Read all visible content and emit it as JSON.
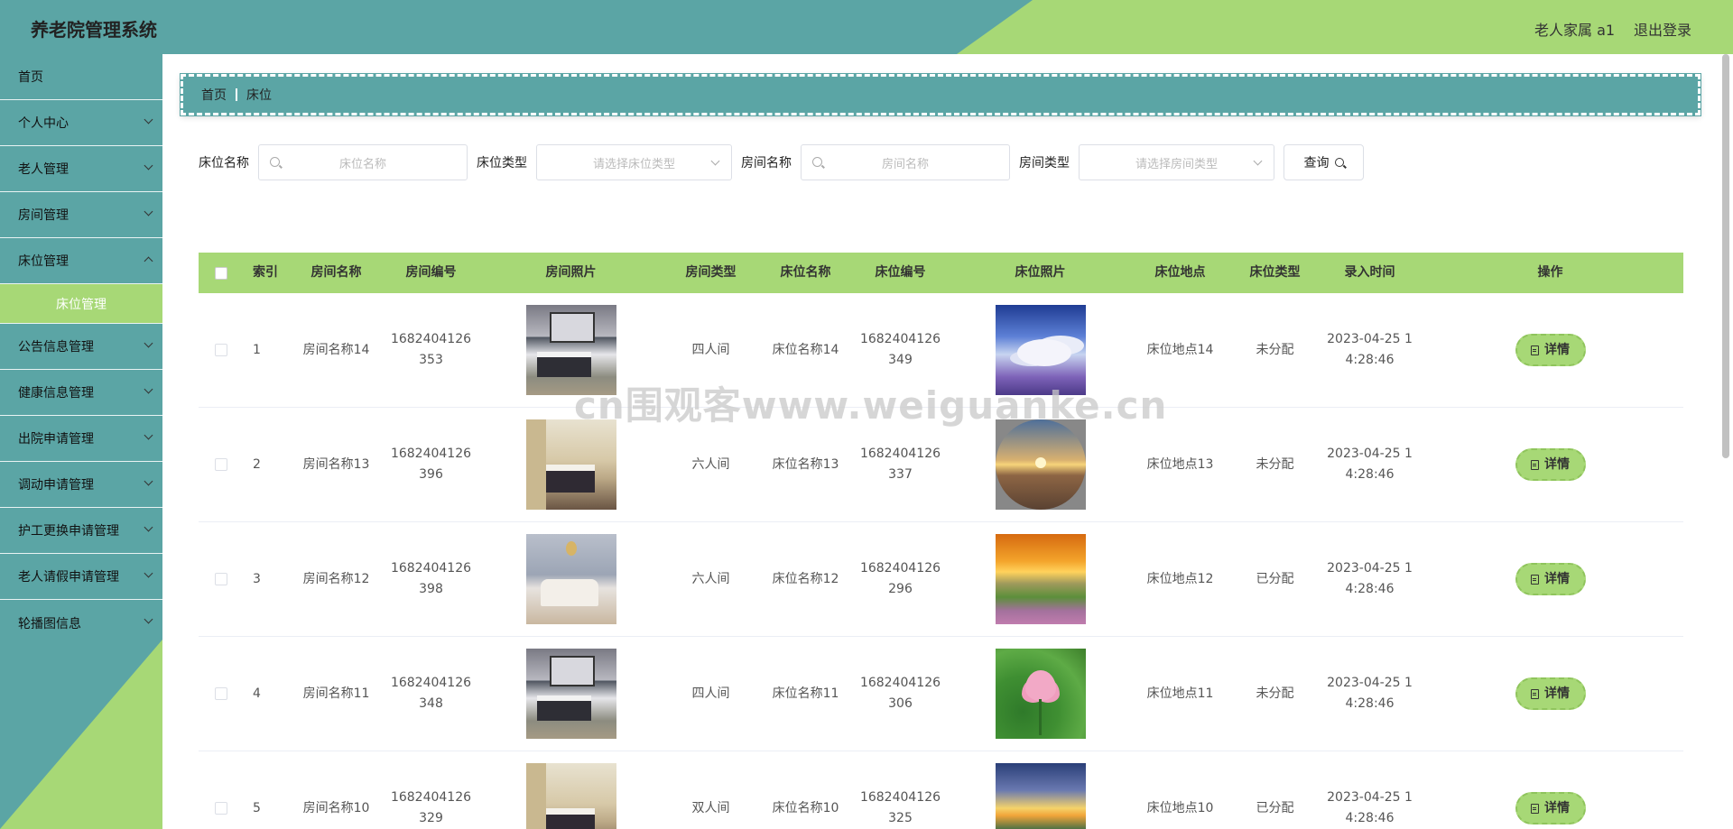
{
  "header": {
    "title": "养老院管理系统",
    "user": "老人家属 a1",
    "logout": "退出登录"
  },
  "colors": {
    "teal": "#5ba5a5",
    "green": "#a7d876"
  },
  "sidebar": {
    "items": [
      {
        "label": "首页"
      },
      {
        "label": "个人中心"
      },
      {
        "label": "老人管理"
      },
      {
        "label": "房间管理"
      },
      {
        "label": "床位管理"
      },
      {
        "label": "公告信息管理"
      },
      {
        "label": "健康信息管理"
      },
      {
        "label": "出院申请管理"
      },
      {
        "label": "调动申请管理"
      },
      {
        "label": "护工更换申请管理"
      },
      {
        "label": "老人请假申请管理"
      },
      {
        "label": "轮播图信息"
      }
    ],
    "active_sub": "床位管理"
  },
  "breadcrumb": {
    "home": "首页",
    "current": "床位"
  },
  "search": {
    "bed_name_label": "床位名称",
    "bed_name_placeholder": "床位名称",
    "bed_type_label": "床位类型",
    "bed_type_placeholder": "请选择床位类型",
    "room_name_label": "房间名称",
    "room_name_placeholder": "房间名称",
    "room_type_label": "房间类型",
    "room_type_placeholder": "请选择房间类型",
    "query_label": "查询"
  },
  "table": {
    "headers": {
      "index": "索引",
      "room_name": "房间名称",
      "room_no": "房间编号",
      "room_photo": "房间照片",
      "room_type": "房间类型",
      "bed_name": "床位名称",
      "bed_no": "床位编号",
      "bed_photo": "床位照片",
      "bed_location": "床位地点",
      "bed_type": "床位类型",
      "time": "录入时间",
      "op": "操作"
    },
    "detail_label": "详情",
    "rows": [
      {
        "index": "1",
        "room_name": "房间名称14",
        "room_no": "1682404126353",
        "room_type": "四人间",
        "bed_name": "床位名称14",
        "bed_no": "1682404126349",
        "bed_location": "床位地点14",
        "bed_type": "未分配",
        "time": "2023-04-25 14:28:46",
        "room_img": "room-a",
        "bed_img": "bed-sky"
      },
      {
        "index": "2",
        "room_name": "房间名称13",
        "room_no": "1682404126396",
        "room_type": "六人间",
        "bed_name": "床位名称13",
        "bed_no": "1682404126337",
        "bed_location": "床位地点13",
        "bed_type": "未分配",
        "time": "2023-04-25 14:28:46",
        "room_img": "room-b",
        "bed_img": "bed-sunset"
      },
      {
        "index": "3",
        "room_name": "房间名称12",
        "room_no": "1682404126398",
        "room_type": "六人间",
        "bed_name": "床位名称12",
        "bed_no": "1682404126296",
        "bed_location": "床位地点12",
        "bed_type": "已分配",
        "time": "2023-04-25 14:28:46",
        "room_img": "room-c",
        "bed_img": "bed-field"
      },
      {
        "index": "4",
        "room_name": "房间名称11",
        "room_no": "1682404126348",
        "room_type": "四人间",
        "bed_name": "床位名称11",
        "bed_no": "1682404126306",
        "bed_location": "床位地点11",
        "bed_type": "未分配",
        "time": "2023-04-25 14:28:46",
        "room_img": "room-a",
        "bed_img": "bed-lotus"
      },
      {
        "index": "5",
        "room_name": "房间名称10",
        "room_no": "1682404126329",
        "room_type": "双人间",
        "bed_name": "床位名称10",
        "bed_no": "1682404126325",
        "bed_location": "床位地点10",
        "bed_type": "已分配",
        "time": "2023-04-25 14:28:46",
        "room_img": "room-b",
        "bed_img": "bed-sunrise"
      }
    ]
  },
  "watermark": "cn围观客www.weiguanke.cn"
}
